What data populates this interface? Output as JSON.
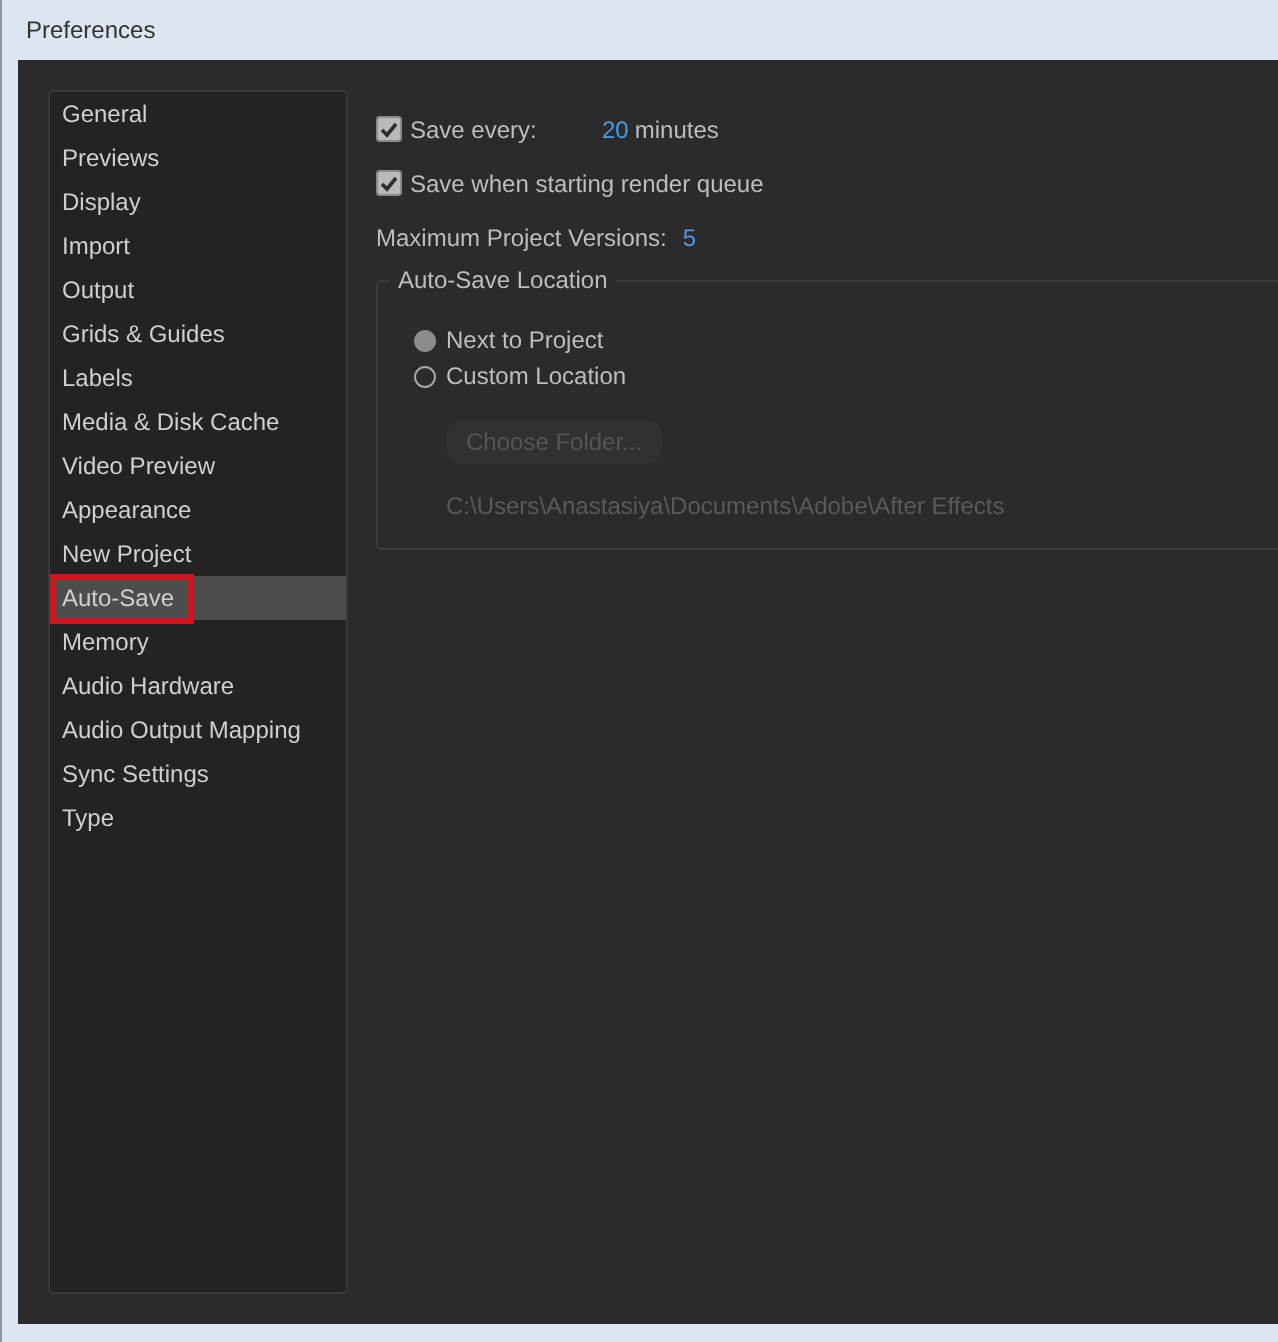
{
  "window": {
    "title": "Preferences"
  },
  "sidebar": {
    "items": [
      {
        "label": "General",
        "selected": false,
        "annotated": false
      },
      {
        "label": "Previews",
        "selected": false,
        "annotated": false
      },
      {
        "label": "Display",
        "selected": false,
        "annotated": false
      },
      {
        "label": "Import",
        "selected": false,
        "annotated": false
      },
      {
        "label": "Output",
        "selected": false,
        "annotated": false
      },
      {
        "label": "Grids & Guides",
        "selected": false,
        "annotated": false
      },
      {
        "label": "Labels",
        "selected": false,
        "annotated": false
      },
      {
        "label": "Media & Disk Cache",
        "selected": false,
        "annotated": false
      },
      {
        "label": "Video Preview",
        "selected": false,
        "annotated": false
      },
      {
        "label": "Appearance",
        "selected": false,
        "annotated": false
      },
      {
        "label": "New Project",
        "selected": false,
        "annotated": false
      },
      {
        "label": "Auto-Save",
        "selected": true,
        "annotated": true
      },
      {
        "label": "Memory",
        "selected": false,
        "annotated": false
      },
      {
        "label": "Audio Hardware",
        "selected": false,
        "annotated": false
      },
      {
        "label": "Audio Output Mapping",
        "selected": false,
        "annotated": false
      },
      {
        "label": "Sync Settings",
        "selected": false,
        "annotated": false
      },
      {
        "label": "Type",
        "selected": false,
        "annotated": false
      }
    ]
  },
  "auto_save": {
    "save_every": {
      "label": "Save every:",
      "checked": true,
      "value": "20",
      "unit": "minutes"
    },
    "save_on_render": {
      "label": "Save when starting render queue",
      "checked": true
    },
    "max_versions": {
      "label": "Maximum Project Versions:",
      "value": "5"
    },
    "location": {
      "title": "Auto-Save Location",
      "options": [
        {
          "label": "Next to Project",
          "selected": true
        },
        {
          "label": "Custom Location",
          "selected": false
        }
      ],
      "choose_button": {
        "label": "Choose Folder...",
        "disabled": true
      },
      "path": {
        "text": "C:\\Users\\Anastasiya\\Documents\\Adobe\\After Effects",
        "disabled": true
      }
    }
  }
}
